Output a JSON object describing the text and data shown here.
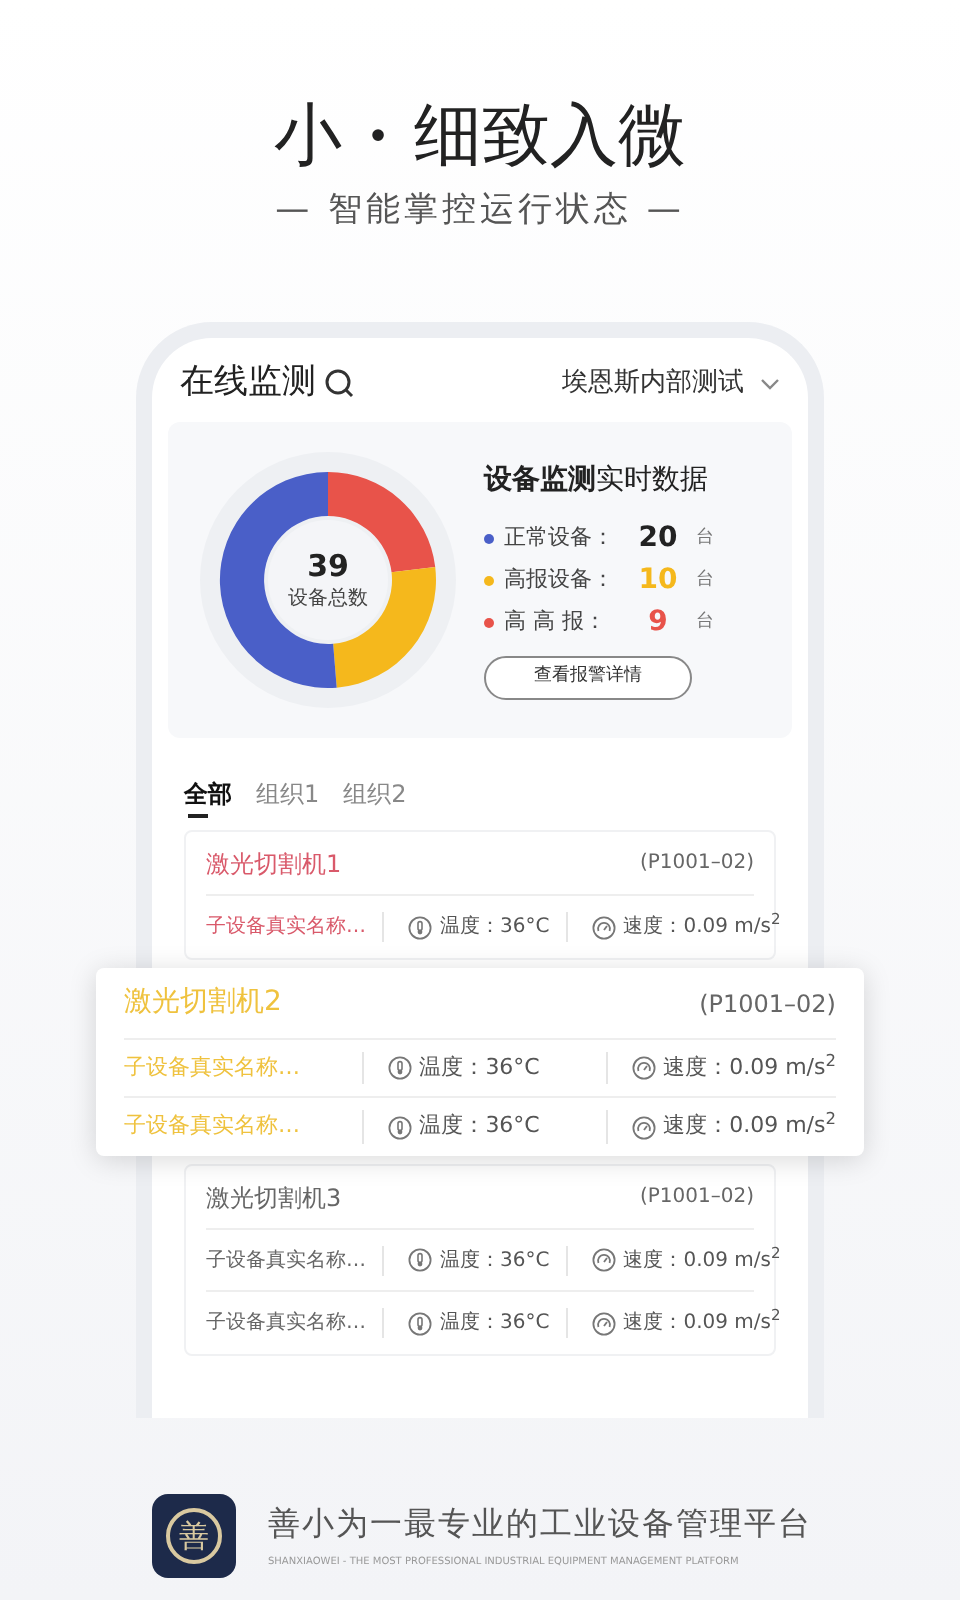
{
  "headline": {
    "main": "小",
    "separator": "•",
    "rest": "细致入微"
  },
  "subtitle": "— 智能掌控运行状态 —",
  "app": {
    "title": "在线监测",
    "org": "埃恩斯内部测试",
    "summary": {
      "total": "39",
      "total_label": "设备总数",
      "heading_bold": "设备监测",
      "heading_rest": "实时数据",
      "legend": [
        {
          "label": "正常设备：",
          "count": "20",
          "unit": "台",
          "color": "#4a5fc8"
        },
        {
          "label": "高报设备：",
          "count": "10",
          "unit": "台",
          "color": "#f5b81c"
        },
        {
          "label": "高 高 报：",
          "count": "9",
          "unit": "台",
          "color": "#e8534a"
        }
      ],
      "button": "查看报警详情"
    },
    "tabs": [
      {
        "label": "全部",
        "selected": true
      },
      {
        "label": "组织1",
        "selected": false
      },
      {
        "label": "组织2",
        "selected": false
      }
    ],
    "devices": [
      {
        "name": "激光切割机1",
        "code": "(P1001–02)",
        "color": "#d9596a",
        "highlighted": false,
        "rows": [
          {
            "sub": "子设备真实名称…",
            "temp": "温度：36°C",
            "speed": "速度：0.09 m/s$^{2}$"
          }
        ]
      },
      {
        "name": "激光切割机2",
        "code": "(P1001–02)",
        "color": "#efc23e",
        "highlighted": true,
        "rows": [
          {
            "sub": "子设备真实名称…",
            "temp": "温度：36°C",
            "speed": "速度：0.09 m/s$^{2}$"
          },
          {
            "sub": "子设备真实名称…",
            "temp": "温度：36°C",
            "speed": "速度：0.09 m/s$^{2}$"
          }
        ]
      },
      {
        "name": "激光切割机3",
        "code": "(P1001–02)",
        "color": "#666666",
        "highlighted": false,
        "rows": [
          {
            "sub": "子设备真实名称…",
            "temp": "温度：36°C",
            "speed": "速度：0.09 m/s$^{2}$"
          },
          {
            "sub": "子设备真实名称…",
            "temp": "温度：36°C",
            "speed": "速度：0.09 m/s$^{2}$"
          }
        ]
      }
    ]
  },
  "footer": {
    "logo_char": "善",
    "slogan": "善小为一最专业的工业设备管理平台",
    "tagline": "SHANXIAOWEI - THE MOST PROFESSIONAL INDUSTRIAL EQUIPMENT MANAGEMENT PLATFORM"
  }
}
